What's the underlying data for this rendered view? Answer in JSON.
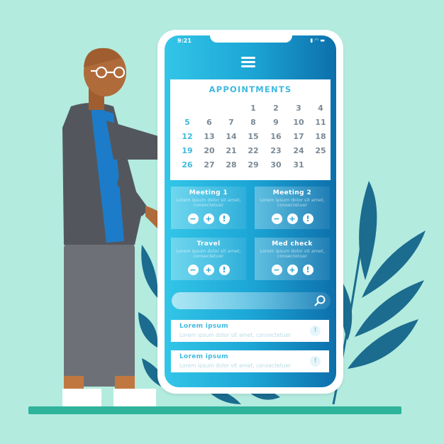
{
  "status_bar": {
    "time": "9:21",
    "icons": [
      "signal-icon",
      "wifi-icon",
      "battery-icon"
    ]
  },
  "header": {
    "menu_icon": "hamburger-menu-icon"
  },
  "calendar": {
    "title": "APPOINTMENTS",
    "first_weekday_index": 3,
    "days": [
      "1",
      "2",
      "3",
      "4",
      "5",
      "6",
      "7",
      "8",
      "9",
      "10",
      "11",
      "12",
      "13",
      "14",
      "15",
      "16",
      "17",
      "18",
      "19",
      "20",
      "21",
      "22",
      "23",
      "24",
      "25",
      "26",
      "27",
      "28",
      "29",
      "30",
      "31"
    ]
  },
  "cards": [
    {
      "title": "Meeting 1",
      "text": "Lorem ipsum dolor sit amet, consectetuer"
    },
    {
      "title": "Meeting 2",
      "text": "Lorem ipsum dolor sit amet, consectetuer"
    },
    {
      "title": "Travel",
      "text": "Lorem ipsum dolor sit amet, consectetuer"
    },
    {
      "title": "Med check",
      "text": "Lorem ipsum dolor sit amet, consectetuer"
    }
  ],
  "card_buttons": {
    "minus": "−",
    "plus": "+",
    "alert": "!"
  },
  "search": {
    "placeholder": "",
    "icon": "search-icon"
  },
  "list": [
    {
      "title": "Lorem ipsum",
      "text": "Lorem ipsum dolor sit amet, consectetuer",
      "badge": "!"
    },
    {
      "title": "Lorem ipsum",
      "text": "Lorem ipsum dolor sit amet, consectetuer",
      "badge": "!"
    }
  ],
  "colors": {
    "background": "#b3ebdf",
    "accent": "#3fb9e0",
    "screen_dark": "#0d6fab",
    "ground": "#2fb39b",
    "leaves": "#1b6c8e"
  }
}
